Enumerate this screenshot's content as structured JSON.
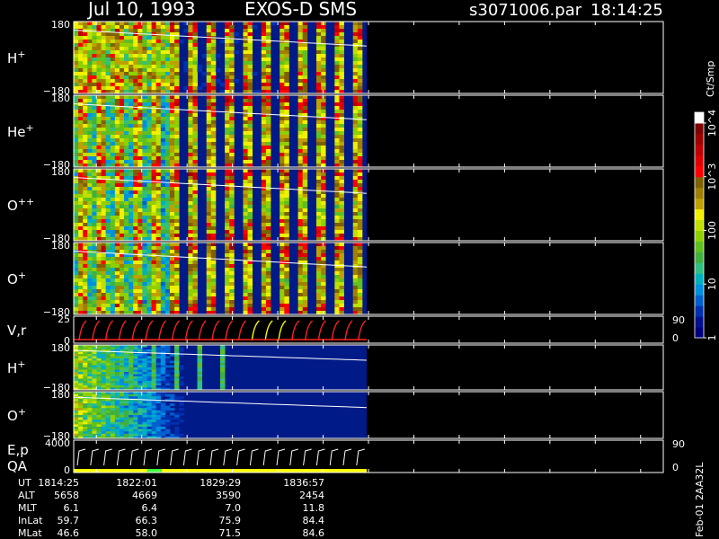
{
  "header": {
    "date": "Jul 10, 1993",
    "instrument": "EXOS-D SMS",
    "file": "s3071006.par",
    "time": "18:14:25"
  },
  "colorbar": {
    "unit": "Ct/Smp",
    "ticks": [
      {
        "label": "1",
        "value": 1
      },
      {
        "label": "10",
        "value": 10
      },
      {
        "label": "100",
        "value": 100
      },
      {
        "label": "10^3",
        "value": 1000
      },
      {
        "label": "10^4",
        "value": 10000
      }
    ],
    "colors": [
      "#00007f",
      "#001090",
      "#0030b0",
      "#0060d0",
      "#0090e0",
      "#00b0c0",
      "#30c080",
      "#40b040",
      "#60c020",
      "#90d000",
      "#c0e000",
      "#f0f000",
      "#c0a000",
      "#a08000",
      "#806000",
      "#ff0000",
      "#e00000",
      "#c00000",
      "#a00000",
      "#800000",
      "#ffffff"
    ]
  },
  "panels": [
    {
      "id": "h-plus",
      "label": "H",
      "sup": "+",
      "ymax": "180",
      "ymin": "−180",
      "type": "spectrogram",
      "active_until": 0.56
    },
    {
      "id": "he-plus",
      "label": "He",
      "sup": "+",
      "ymax": "180",
      "ymin": "−180",
      "type": "spectrogram",
      "active_until": 0.56
    },
    {
      "id": "o-plus-plus",
      "label": "O",
      "sup": "++",
      "ymax": "180",
      "ymin": "−180",
      "type": "spectrogram",
      "active_until": 0.56
    },
    {
      "id": "o-plus",
      "label": "O",
      "sup": "+",
      "ymax": "180",
      "ymin": "−180",
      "type": "spectrogram",
      "active_until": 0.56
    },
    {
      "id": "v-r",
      "label": "V,r",
      "sup": "",
      "ymax": "25",
      "ymin": "0",
      "rmax": "90",
      "rmin": "0",
      "type": "line"
    },
    {
      "id": "h-plus-2",
      "label": "H",
      "sup": "+",
      "ymax": "180",
      "ymin": "−180",
      "type": "spectrogram2",
      "active_until": 0.56
    },
    {
      "id": "o-plus-2",
      "label": "O",
      "sup": "+",
      "ymax": "180",
      "ymin": "−180",
      "type": "spectrogram2",
      "active_until": 0.56
    },
    {
      "id": "e-p-qa",
      "label": "E,p",
      "label2": "QA",
      "sup": "",
      "ymax": "4000",
      "ymin": "0",
      "rmax": "90",
      "rmin": "0",
      "type": "ep"
    }
  ],
  "ephemeris": {
    "rows": [
      {
        "name": "UT",
        "values": [
          "1814:25",
          "1822:01",
          "1829:29",
          "1836:57"
        ]
      },
      {
        "name": "ALT",
        "values": [
          "5658",
          "4669",
          "3590",
          "2454"
        ]
      },
      {
        "name": "MLT",
        "values": [
          "6.1",
          "6.4",
          "7.0",
          "11.8"
        ]
      },
      {
        "name": "InLat",
        "values": [
          "59.7",
          "66.3",
          "75.9",
          "84.4"
        ]
      },
      {
        "name": "MLat",
        "values": [
          "46.6",
          "58.0",
          "71.5",
          "84.6"
        ]
      }
    ]
  },
  "side_label": "Feb-01 2AA32L"
}
